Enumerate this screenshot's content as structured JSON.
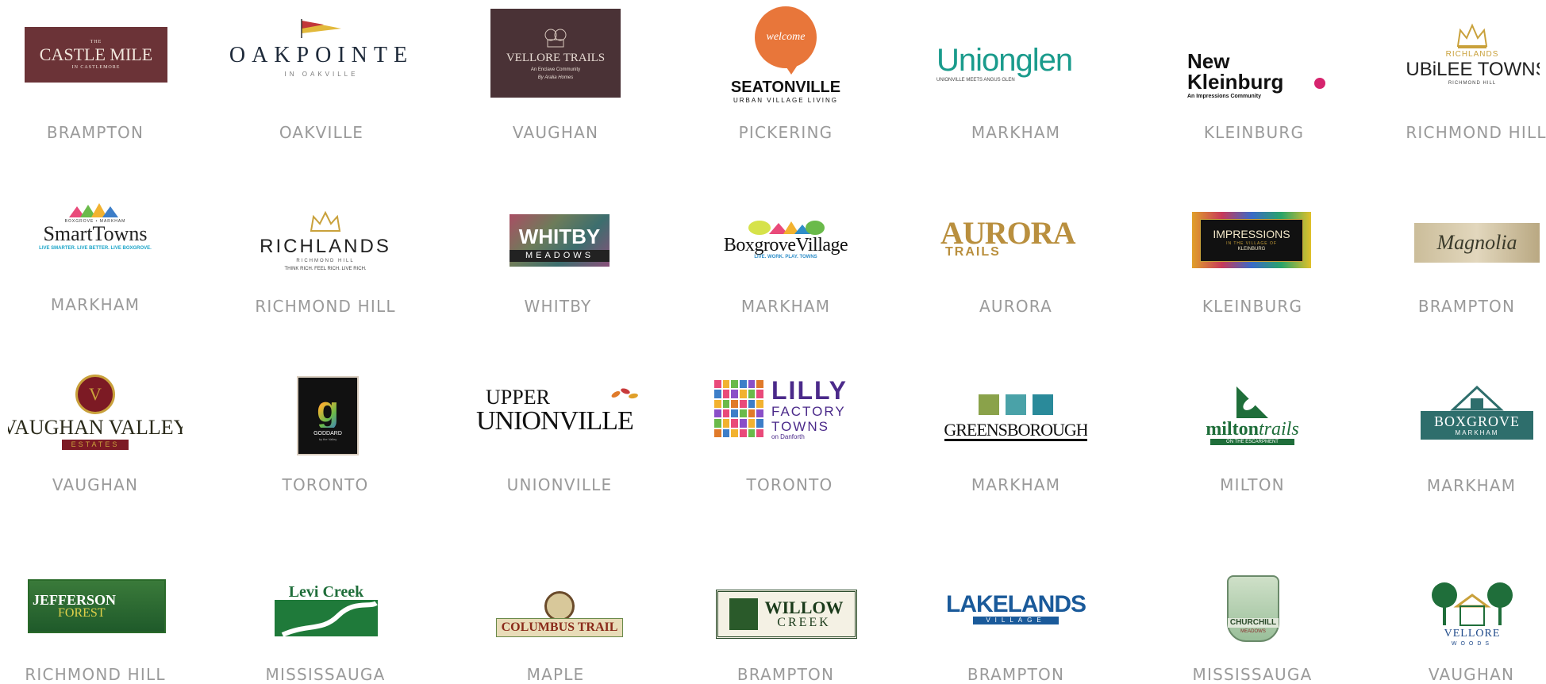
{
  "colors": {
    "city_text": "#9a9a9a",
    "castle_bg": "#6b3337",
    "vellore_bg": "#4a3236",
    "seaton_orange": "#e8763a",
    "unionglen_teal": "#1a9b8c",
    "gold": "#c9a13b",
    "lilly_purple": "#4b2a8a",
    "milton_green": "#1f6e3a",
    "boxgrove_teal": "#2e6e6c"
  },
  "projects": [
    {
      "city": "BRAMPTON",
      "logo": {
        "line1": "THE",
        "line2": "CASTLE MILE",
        "line3": "IN CASTLEMORE"
      }
    },
    {
      "city": "OAKVILLE",
      "logo": {
        "line1": "OAKPOINTE",
        "line2": "IN OAKVILLE"
      }
    },
    {
      "city": "VAUGHAN",
      "logo": {
        "line1": "VELLORE TRAILS",
        "line2": "An Enclave Community",
        "line3": "By Aralia Homes"
      }
    },
    {
      "city": "PICKERING",
      "logo": {
        "badge": "welcome",
        "line1": "SEATONVILLE",
        "line2": "URBAN VILLAGE LIVING"
      }
    },
    {
      "city": "MARKHAM",
      "logo": {
        "line1": "Unionglen",
        "line2": "UNIONVILLE MEETS ANGUS GLEN"
      }
    },
    {
      "city": "KLEINBURG",
      "logo": {
        "line1": "New",
        "line2": "Kleinburg",
        "line3": "An Impressions Community"
      }
    },
    {
      "city": "RICHMOND HILL",
      "logo": {
        "line1": "RICHLANDS",
        "line2": "JUBiLEE TOWNS",
        "line3": "RICHMOND HILL"
      }
    },
    {
      "city": "MARKHAM",
      "logo": {
        "line1": "BOXGROVE • MARKHAM",
        "line2": "SmartTowns",
        "line3": "LIVE SMARTER. LIVE BETTER. LIVE BOXGROVE."
      }
    },
    {
      "city": "RICHMOND  HILL",
      "logo": {
        "line1": "RICHLANDS",
        "line2": "RICHMOND HILL",
        "line3": "THINK RICH. FEEL RICH. LIVE RICH."
      }
    },
    {
      "city": "WHITBY",
      "logo": {
        "line1": "WHITBY",
        "line2": "MEADOWS"
      }
    },
    {
      "city": "MARKHAM",
      "logo": {
        "line1": "BoxgroveVillage",
        "line2": "LIVE. WORK. PLAY. TOWNS"
      }
    },
    {
      "city": "AURORA",
      "logo": {
        "line1": "AURORA",
        "line2": "TRAILS"
      }
    },
    {
      "city": "KLEINBURG",
      "logo": {
        "line1": "IMPRESSIONS",
        "line2": "IN THE VILLAGE OF",
        "line3": "KLEINBURG"
      }
    },
    {
      "city": "BRAMPTON",
      "logo": {
        "line1": "Magnolia"
      }
    },
    {
      "city": "VAUGHAN",
      "logo": {
        "line1": "VAUGHAN VALLEY",
        "line2": "ESTATES"
      }
    },
    {
      "city": "TORONTO",
      "logo": {
        "line1": "GODDARD",
        "line2": "by the Valley"
      }
    },
    {
      "city": "UNIONVILLE",
      "logo": {
        "line1": "UPPER",
        "line2": "UNIONVILLE"
      }
    },
    {
      "city": "TORONTO",
      "logo": {
        "line1": "LILLY",
        "line2": "FACTORY",
        "line3": "TOWNS",
        "line4": "on Danforth"
      }
    },
    {
      "city": "MARKHAM",
      "logo": {
        "line1": "GREENSBOROUGH"
      }
    },
    {
      "city": "MILTON",
      "logo": {
        "line1": "milton",
        "line2": "trails",
        "line3": "ON THE ESCARPMENT"
      }
    },
    {
      "city": "MARKHAM",
      "logo": {
        "line1": "BOXGROVE",
        "line2": "MARKHAM"
      }
    },
    {
      "city": "RICHMOND HILL",
      "logo": {
        "line1": "JEFFERSON",
        "line2": "FOREST"
      }
    },
    {
      "city": "MISSISSAUGA",
      "logo": {
        "line1": "Levi Creek"
      }
    },
    {
      "city": "MAPLE",
      "logo": {
        "line1": "COLUMBUS TRAIL"
      }
    },
    {
      "city": "BRAMPTON",
      "logo": {
        "line1": "WILLOW",
        "line2": "CREEK"
      }
    },
    {
      "city": "BRAMPTON",
      "logo": {
        "line1": "LAKELANDS",
        "line2": "VILLAGE"
      }
    },
    {
      "city": "MISSISSAUGA",
      "logo": {
        "line1": "CHURCHILL",
        "line2": "MEADOWS"
      }
    },
    {
      "city": "VAUGHAN",
      "logo": {
        "line1": "VELLORE",
        "line2": "WOODS"
      }
    }
  ]
}
